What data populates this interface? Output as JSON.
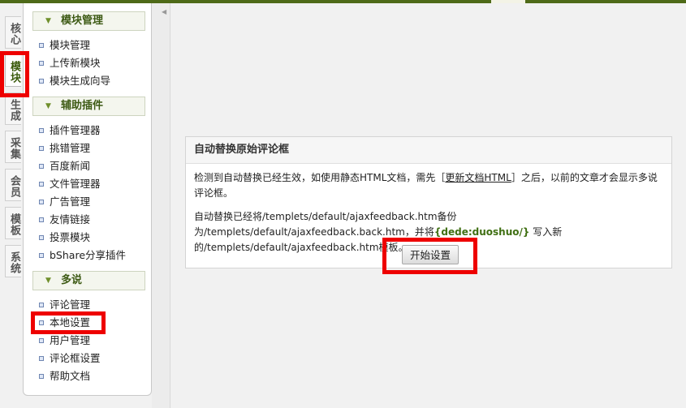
{
  "vertical_tabs": [
    "核心",
    "模块",
    "生成",
    "采集",
    "会员",
    "模板",
    "系统"
  ],
  "sidebar": {
    "groups": [
      {
        "title": "模块管理",
        "items": [
          "模块管理",
          "上传新模块",
          "模块生成向导"
        ]
      },
      {
        "title": "辅助插件",
        "items": [
          "插件管理器",
          "挑错管理",
          "百度新闻",
          "文件管理器",
          "广告管理",
          "友情链接",
          "投票模块",
          "bShare分享插件"
        ]
      },
      {
        "title": "多说",
        "items": [
          "评论管理",
          "本地设置",
          "用户管理",
          "评论框设置",
          "帮助文档"
        ]
      }
    ]
  },
  "panel": {
    "title": "自动替换原始评论框",
    "line1_before": "检测到自动替换已经生效，如使用静态HTML文档，需先［",
    "line1_link": "更新文档HTML",
    "line1_after": "］之后，以前的文章才会显示多说评论框。",
    "line2_before": "自动替换已经将/templets/default/ajaxfeedback.htm备份为/templets/default/ajaxfeedback.back.htm，并将",
    "line2_tag": "{dede:duoshuo/}",
    "line2_after": " 写入新的/templets/default/ajaxfeedback.htm模板。",
    "button": "开始设置"
  },
  "colors": {
    "highlight": "#e00000",
    "accent": "#3d5a14"
  }
}
